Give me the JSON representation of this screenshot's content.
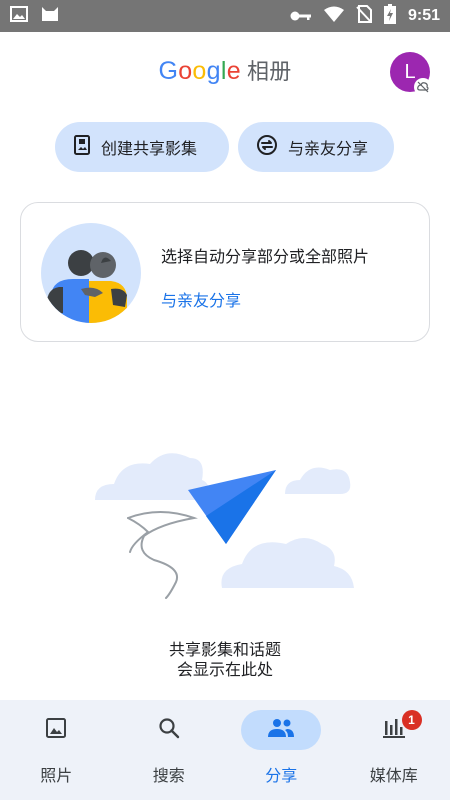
{
  "status_bar": {
    "time": "9:51",
    "icons": [
      "image-icon",
      "cat-icon",
      "key-icon",
      "wifi-icon",
      "no-sim-icon",
      "battery-charging-icon"
    ]
  },
  "app_bar": {
    "logo_letters": [
      "G",
      "o",
      "o",
      "g",
      "l",
      "e"
    ],
    "product_name": "相册",
    "avatar_initial": "L",
    "avatar_color": "#9c27b0"
  },
  "actions": {
    "create_album_label": "创建共享影集",
    "share_with_partner_label": "与亲友分享"
  },
  "partner_card": {
    "title": "选择自动分享部分或全部照片",
    "link": "与亲友分享"
  },
  "empty_state": {
    "line1": "共享影集和话题",
    "line2": "会显示在此处"
  },
  "bottom_nav": {
    "items": [
      {
        "label": "照片",
        "icon": "photo-icon"
      },
      {
        "label": "搜索",
        "icon": "search-icon"
      },
      {
        "label": "分享",
        "icon": "people-icon",
        "active": true
      },
      {
        "label": "媒体库",
        "icon": "library-icon",
        "badge": "1"
      }
    ]
  },
  "colors": {
    "accent": "#1a73e8",
    "chip_bg": "#d2e3fc",
    "nav_bg": "#eef2f9",
    "badge": "#d93025"
  }
}
